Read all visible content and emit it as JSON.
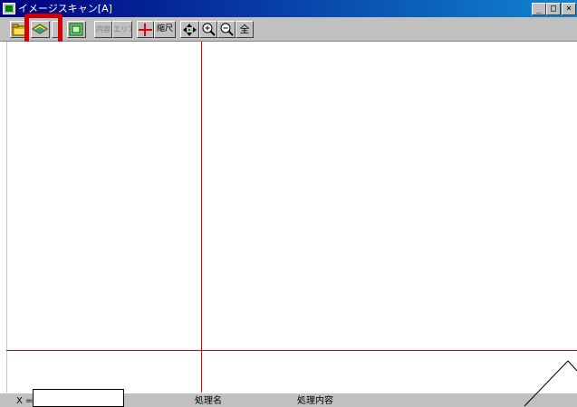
{
  "window": {
    "title": "イメージスキャン[A]",
    "buttons": {
      "minimize": "_",
      "maximize": "□",
      "close": "×"
    }
  },
  "toolbar": {
    "buttons": [
      {
        "icon": "open-folder-icon"
      },
      {
        "icon": "scan-layers-icon",
        "highlighted": true
      },
      {
        "icon": "separator"
      },
      {
        "icon": "frame-select-icon"
      },
      {
        "label": "内容",
        "enabled": false
      },
      {
        "label": "エリア",
        "enabled": false
      },
      {
        "icon": "red-crosshair-icon"
      },
      {
        "label": "縮尺"
      },
      {
        "icon": "move-arrows-icon"
      },
      {
        "icon": "zoom-in-icon"
      },
      {
        "icon": "zoom-out-icon"
      },
      {
        "label": "全"
      }
    ]
  },
  "status": {
    "x_label": "X =",
    "col_process_name": "処理名",
    "col_process_content": "処理内容"
  },
  "colors": {
    "title_gradient_start": "#000080",
    "title_gradient_end": "#1084d0",
    "guide_lines": "#e00000",
    "highlight": "#d40000",
    "chrome": "#c0c0c0"
  }
}
